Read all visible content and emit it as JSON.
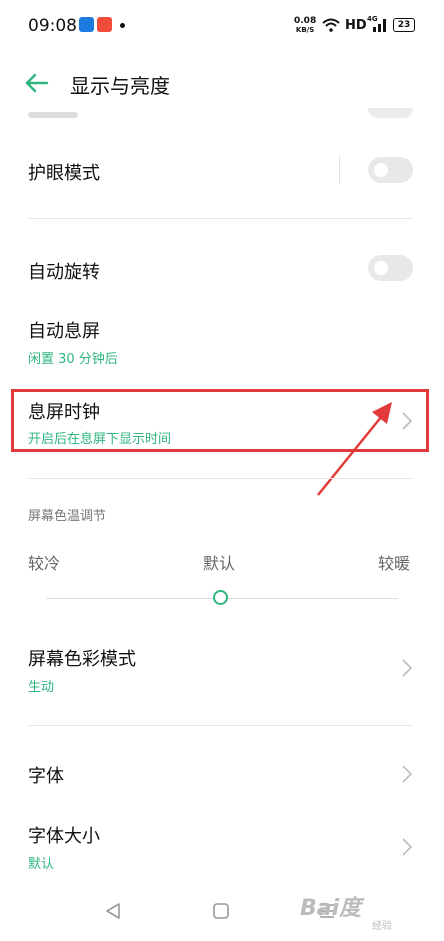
{
  "status_bar": {
    "time": "09:08",
    "net_speed_value": "0.08",
    "net_speed_unit": "KB/S",
    "hd": "HD",
    "signal": "4G",
    "battery": "23"
  },
  "header": {
    "title": "显示与亮度"
  },
  "rows": {
    "eye_protection": {
      "label": "护眼模式"
    },
    "auto_rotate": {
      "label": "自动旋转"
    },
    "auto_screen_off": {
      "label": "自动息屏",
      "sub": "闲置 30 分钟后"
    },
    "aod_clock": {
      "label": "息屏时钟",
      "sub": "开启后在息屏下显示时间"
    },
    "color_temp": {
      "section": "屏幕色温调节",
      "cool": "较冷",
      "default": "默认",
      "warm": "较暖",
      "level": 0.5
    },
    "color_mode": {
      "label": "屏幕色彩模式",
      "sub": "生动"
    },
    "font": {
      "label": "字体"
    },
    "font_size": {
      "label": "字体大小",
      "sub": "默认"
    }
  },
  "watermark": {
    "text": "Bai度",
    "sub": "经验"
  },
  "colors": {
    "accent": "#2fb67f",
    "highlight": "#e23a3a"
  }
}
